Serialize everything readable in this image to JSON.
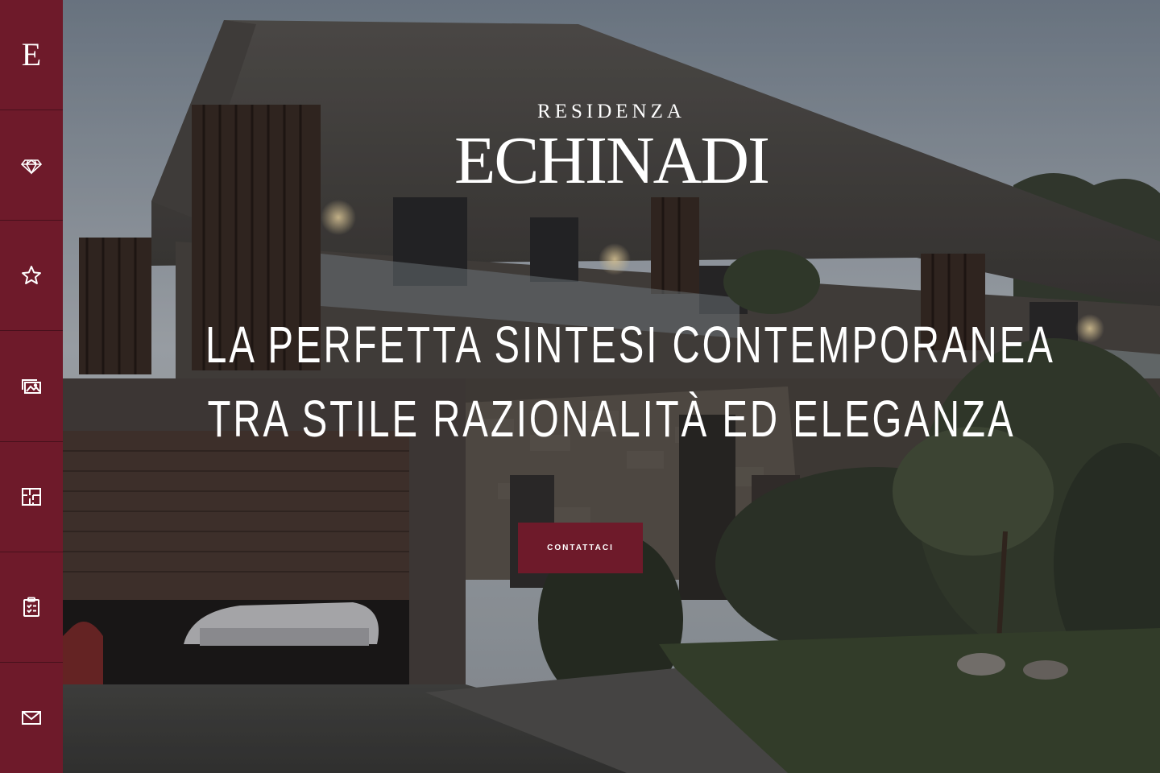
{
  "sidebar": {
    "logo": "E",
    "items": [
      {
        "icon": "diamond-icon"
      },
      {
        "icon": "star-icon"
      },
      {
        "icon": "gallery-icon"
      },
      {
        "icon": "floorplan-icon"
      },
      {
        "icon": "clipboard-icon"
      },
      {
        "icon": "mail-icon"
      }
    ]
  },
  "hero": {
    "brand_small": "RESIDENZA",
    "brand_big": "ECHINADI",
    "headline_line1": "LA PERFETTA SINTESI CONTEMPORANEA",
    "headline_line2": "TRA STILE RAZIONALITÀ ED ELEGANZA",
    "cta_label": "CONTATTACI"
  },
  "colors": {
    "accent": "#6e1a2a",
    "text": "#ffffff"
  }
}
